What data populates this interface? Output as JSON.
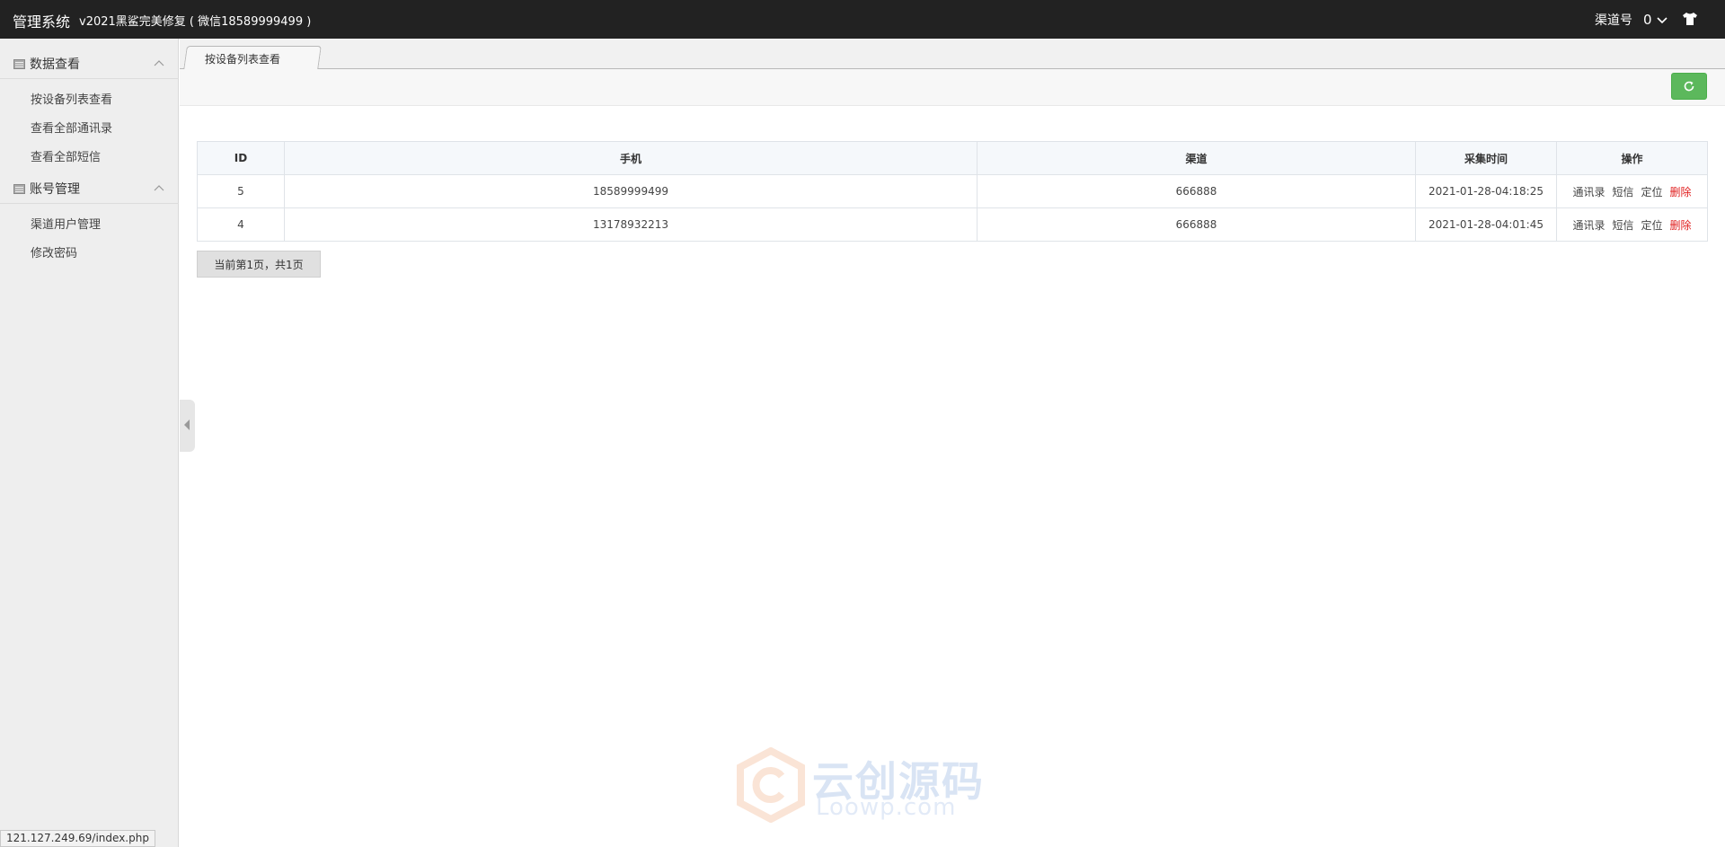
{
  "header": {
    "brand": "管理系统",
    "version": "v2021黑鲨完美修复 ( 微信18589999499 )",
    "channel_label": "渠道号",
    "channel_value": "0"
  },
  "sidebar": {
    "groups": [
      {
        "title": "数据查看",
        "items": [
          "按设备列表查看",
          "查看全部通讯录",
          "查看全部短信"
        ]
      },
      {
        "title": "账号管理",
        "items": [
          "渠道用户管理",
          "修改密码"
        ]
      }
    ]
  },
  "tabs": [
    {
      "label": "按设备列表查看"
    }
  ],
  "table": {
    "headers": [
      "ID",
      "手机",
      "渠道",
      "采集时间",
      "操作"
    ],
    "rows": [
      {
        "id": "5",
        "phone": "18589999499",
        "channel": "666888",
        "time": "2021-01-28-04:18:25"
      },
      {
        "id": "4",
        "phone": "13178932213",
        "channel": "666888",
        "time": "2021-01-28-04:01:45"
      }
    ],
    "actions": [
      "通讯录",
      "短信",
      "定位",
      "删除"
    ]
  },
  "pagination": {
    "text": "当前第1页，共1页"
  },
  "status_url": "121.127.249.69/index.php",
  "watermark": {
    "line1": "云创源码",
    "line2": "Loowp.com"
  },
  "colors": {
    "topbar": "#222222",
    "refresh": "#5cb85c",
    "delete": "#e02020"
  }
}
